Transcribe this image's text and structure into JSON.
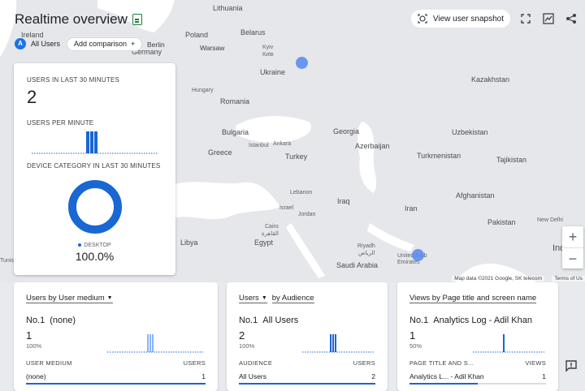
{
  "header": {
    "title": "Realtime overview",
    "segment_avatar": "A",
    "segment_label": "All Users",
    "add_comparison": "Add comparison",
    "add_icon": "+",
    "snapshot_label": "View user snapshot"
  },
  "icons": [
    "report-doc-icon",
    "snapshot-target-icon",
    "fullscreen-icon",
    "insights-icon",
    "share-icon",
    "zoom-in-icon",
    "zoom-out-icon",
    "feedback-icon",
    "dropdown-caret-icon"
  ],
  "map": {
    "labels": {
      "lithuania": "Lithuania",
      "ireland": "Ireland",
      "berlin": "Berlin",
      "germany": "Germany",
      "poland": "Poland",
      "warsaw": "Warsaw",
      "belarus": "Belarus",
      "kyiv": "Kyiv",
      "kyiv_local": "Київ",
      "ukraine": "Ukraine",
      "kazakhstan": "Kazakhstan",
      "hungary": "Hungary",
      "romania": "Romania",
      "bulgaria": "Bulgaria",
      "greece": "Greece",
      "istanbul": "İstanbul",
      "ankara": "Ankara",
      "turkey": "Turkey",
      "georgia": "Georgia",
      "azerbaijan": "Azerbaijan",
      "uzbekistan": "Uzbekistan",
      "turkmenistan": "Turkmenistan",
      "tajikistan": "Tajikistan",
      "lebanon": "Lebanon",
      "israel": "Israel",
      "iraq": "Iraq",
      "jordan": "Jordan",
      "afghanistan": "Afghanistan",
      "iran": "Iran",
      "pakistan": "Pakistan",
      "libya": "Libya",
      "cairo": "Cairo",
      "cairo_local": "القاهرة",
      "egypt": "Egypt",
      "riyadh": "Riyadh",
      "riyadh_local": "الرياض",
      "saudi_arabia": "Saudi Arabia",
      "uae": "United Arab Emirates",
      "new_delhi": "New Delhi",
      "india": "India",
      "tunisia": "Tunisia"
    },
    "attribution": "Map data ©2021 Google, SK telecom",
    "terms": "Terms of Us",
    "zoom_in": "+",
    "zoom_out": "−",
    "markers": [
      {
        "label": "Ukraine",
        "value": 1
      },
      {
        "label": "United Arab Emirates",
        "value": 1
      }
    ]
  },
  "overlay": {
    "users_caption": "USERS IN LAST 30 MINUTES",
    "users_value": "2",
    "per_minute_caption": "USERS PER MINUTE",
    "device_caption": "DEVICE CATEGORY IN LAST 30 MINUTES",
    "device_legend": "DESKTOP",
    "device_value": "100.0%",
    "primary_color": "#1967d2"
  },
  "cards": [
    {
      "title": "Users by User medium",
      "rank": "No.1",
      "top_item": "(none)",
      "top_value": "1",
      "top_pct": "100%",
      "col_left": "USER MEDIUM",
      "col_right": "USERS",
      "row_label": "(none)",
      "row_value": "1"
    },
    {
      "title_a": "Users",
      "title_b": "by Audience",
      "rank": "No.1",
      "top_item": "All Users",
      "top_value": "2",
      "top_pct": "100%",
      "col_left": "AUDIENCE",
      "col_right": "USERS",
      "row_label": "All Users",
      "row_value": "2"
    },
    {
      "title": "Views by Page title and screen name",
      "rank": "No.1",
      "top_item": "Analytics Log - Adil Khan",
      "top_value": "1",
      "top_pct": "50%",
      "col_left": "PAGE TITLE AND S...",
      "col_right": "VIEWS",
      "row_label": "Analytics L... - Adil Khan",
      "row_value": "1"
    }
  ]
}
